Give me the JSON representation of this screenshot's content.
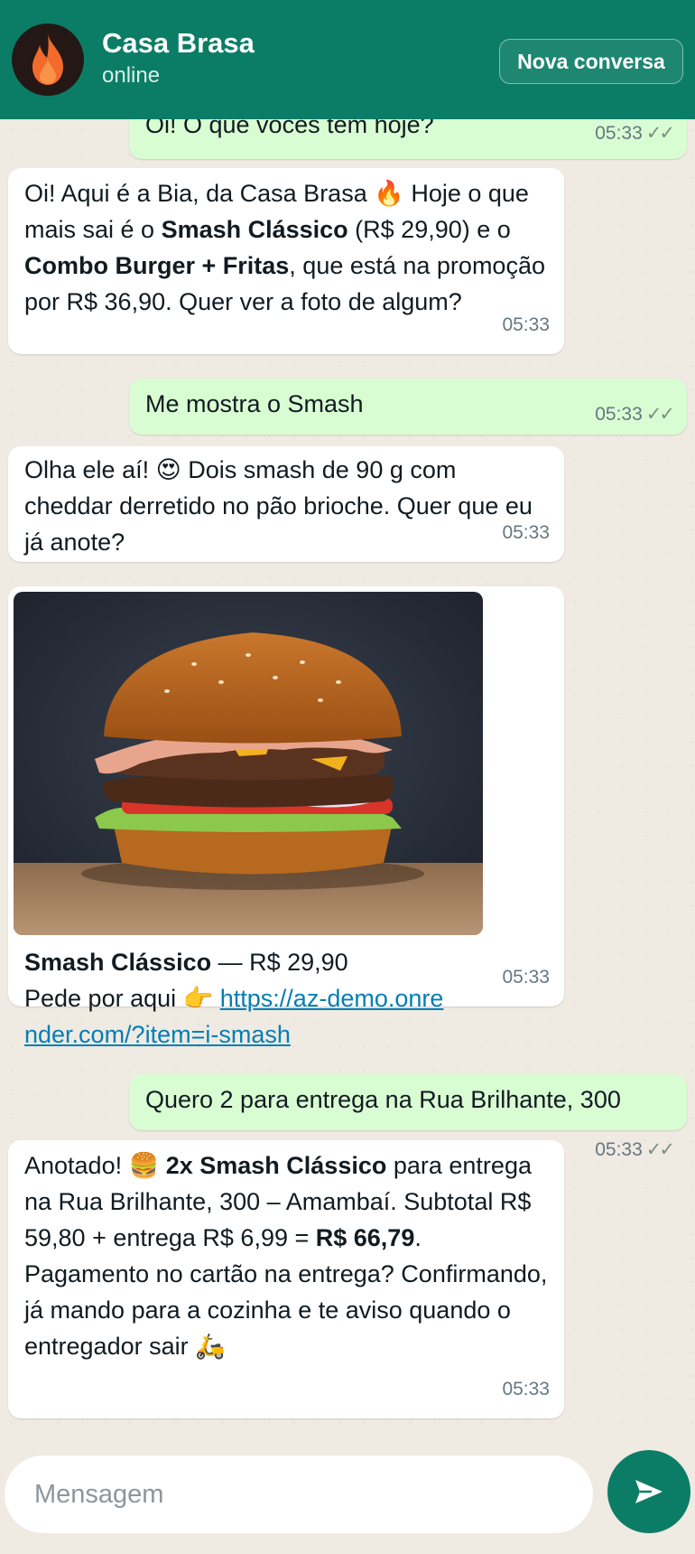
{
  "header": {
    "title": "Casa Brasa",
    "status": "online",
    "new_chat_label": "Nova conversa"
  },
  "messages": [
    {
      "from": "me",
      "text": "Oi! O que vocês têm hoje?",
      "time": "05:33",
      "ticks": "✓✓"
    },
    {
      "from": "bot",
      "parts": [
        "Oi! Aqui é a Bia, da Casa Brasa 🔥 Hoje o que mais sai é o ",
        "Smash Clássico",
        " (R$ 29,90) e o ",
        "Combo Burger + Fritas",
        ", que está na promoção por R$ 36,90. Quer ver a foto de algum?"
      ],
      "time": "05:33"
    },
    {
      "from": "me",
      "text": "Me mostra o Smash",
      "time": "05:33",
      "ticks": "✓✓"
    },
    {
      "from": "bot",
      "text": "Olha ele aí! 😍 Dois smash de 90 g com cheddar derretido no pão brioche. Quer que eu já anote?",
      "time": "05:33"
    },
    {
      "from": "bot",
      "image": "burger-photo",
      "caption_bold": "Smash Clássico",
      "caption_rest": " — R$ 29,90",
      "line2": "Pede por aqui 👉 ",
      "link": "https://az-demo.onrender.com/?item=i-smash",
      "time": "05:33"
    },
    {
      "from": "me",
      "text": "Quero 2 para entrega na Rua Brilhante, 300",
      "time": "05:33",
      "ticks": "✓✓"
    },
    {
      "from": "bot",
      "parts": [
        "Anotado! 🍔 ",
        "2x Smash Clássico",
        " para entrega na Rua Brilhante, 300 – Amambaí. Subtotal R$ 59,80 + entrega R$ 6,99 = ",
        "R$ 66,79",
        "."
      ],
      "line2": "Pagamento no cartão na entrega? Confirmando, já mando para a cozinha e te aviso quando o entregador sair 🛵",
      "time": "05:33"
    }
  ],
  "composer": {
    "placeholder": "Mensagem"
  },
  "icons": {
    "avatar": "flame-logo-icon",
    "send": "send-arrow-icon",
    "read": "double-check-icon"
  },
  "colors": {
    "brand": "#0b7d66",
    "outgoing_bubble": "#d9fdd3",
    "incoming_bubble": "#ffffff",
    "chat_bg": "#efeae2",
    "link": "#027eb5"
  }
}
